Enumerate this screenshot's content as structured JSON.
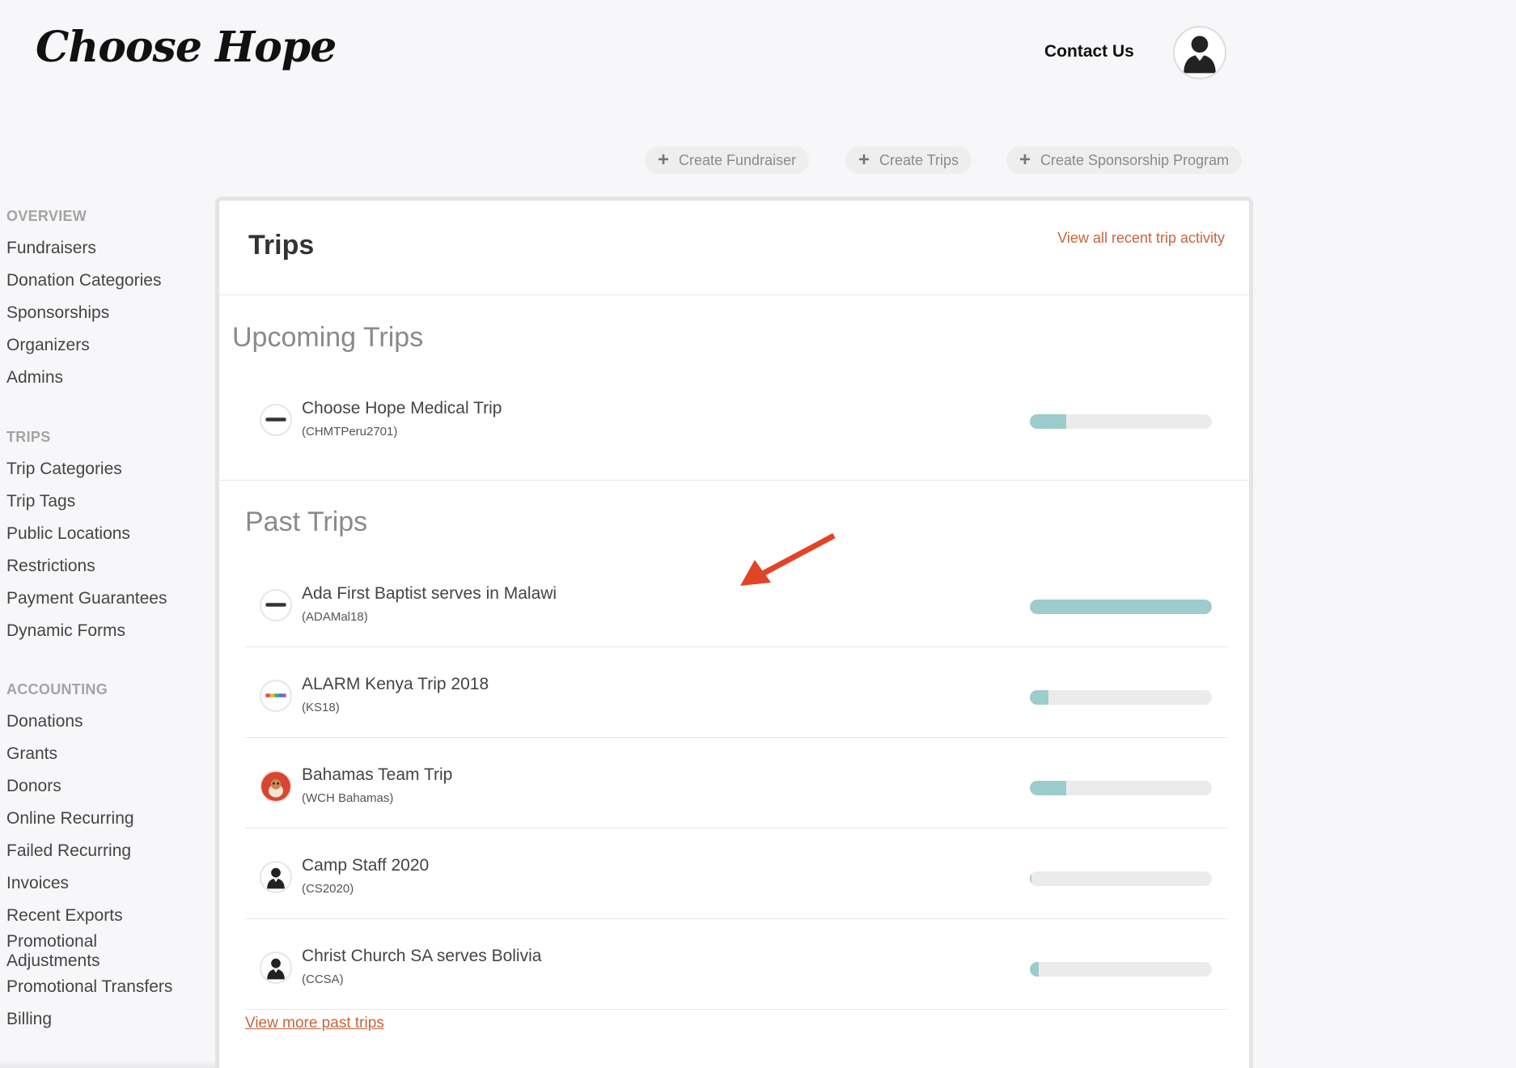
{
  "header": {
    "logo_text": "Choose Hope",
    "contact_label": "Contact Us"
  },
  "actions": [
    {
      "label": "Create Fundraiser",
      "icon": "plus-icon"
    },
    {
      "label": "Create Trips",
      "icon": "plus-icon"
    },
    {
      "label": "Create Sponsorship Program",
      "icon": "plus-icon"
    }
  ],
  "sidebar": {
    "overview_heading": "OVERVIEW",
    "overview_items": [
      "Fundraisers",
      "Donation Categories",
      "Sponsorships",
      "Organizers",
      "Admins"
    ],
    "trips_heading": "TRIPS",
    "trips_items": [
      "Trip Categories",
      "Trip Tags",
      "Public Locations",
      "Restrictions",
      "Payment Guarantees",
      "Dynamic Forms"
    ],
    "accounting_heading": "ACCOUNTING",
    "accounting_items": [
      "Donations",
      "Grants",
      "Donors",
      "Online Recurring",
      "Failed Recurring",
      "Invoices",
      "Recent Exports",
      "Promotional Adjustments",
      "Promotional Transfers",
      "Billing"
    ]
  },
  "panel": {
    "title": "Trips",
    "activity_link": "View all recent trip activity",
    "upcoming_title": "Upcoming Trips",
    "past_title": "Past Trips",
    "view_more_link": "View more past trips"
  },
  "upcoming_trips": [
    {
      "name": "Choose Hope Medical Trip",
      "code": "(CHMTPeru2701)",
      "progress": 0.2,
      "thumb": "choose-hope-logo-icon"
    }
  ],
  "past_trips": [
    {
      "name": "Ada First Baptist serves in Malawi",
      "code": "(ADAMal18)",
      "progress": 1.0,
      "thumb": "choose-hope-logo-icon"
    },
    {
      "name": "ALARM Kenya Trip 2018",
      "code": "(KS18)",
      "progress": 0.1,
      "thumb": "alarm-logo-icon"
    },
    {
      "name": "Bahamas Team Trip",
      "code": "(WCH Bahamas)",
      "progress": 0.2,
      "thumb": "dog-photo-icon"
    },
    {
      "name": "Camp Staff 2020",
      "code": "(CS2020)",
      "progress": 0.01,
      "thumb": "user-silhouette-icon"
    },
    {
      "name": "Christ Church SA serves Bolivia",
      "code": "(CCSA)",
      "progress": 0.05,
      "thumb": "user-silhouette-icon"
    }
  ],
  "colors": {
    "accent_link": "#c8643a",
    "progress_fill": "#9ccccb",
    "progress_track": "#ebebeb"
  }
}
